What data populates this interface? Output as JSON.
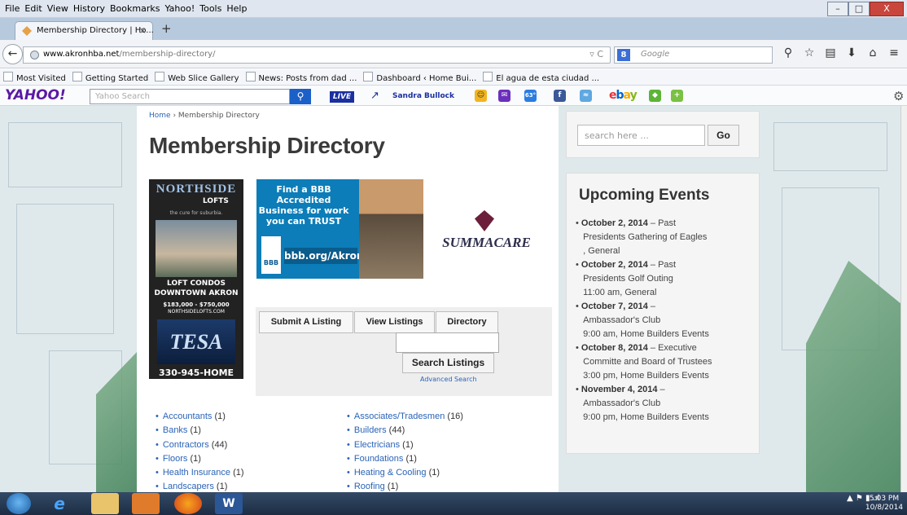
{
  "browser": {
    "menu": [
      "File",
      "Edit",
      "View",
      "History",
      "Bookmarks",
      "Yahoo!",
      "Tools",
      "Help"
    ],
    "tab_title": "Membership Directory | Ho...",
    "tab_close": "×",
    "new_tab": "+",
    "url_host": "www.akronhba.net",
    "url_path": "/membership-directory/",
    "url_controls": "▿ C",
    "search_engine_placeholder": "Google",
    "bookmarks": [
      "Most Visited",
      "Getting Started",
      "Web Slice Gallery",
      "News: Posts from dad ...",
      "Dashboard ‹ Home Bui...",
      "El agua de esta ciudad ..."
    ],
    "window_controls": [
      "–",
      "□",
      "X"
    ]
  },
  "yahoo_toolbar": {
    "logo": "YAHOO!",
    "search_placeholder": "Yahoo Search",
    "live_label": "LIVE",
    "trending_name": "Sandra Bullock",
    "weather_temp": "63°",
    "ebay_label": "ebay"
  },
  "page": {
    "breadcrumb_home": "Home",
    "breadcrumb_sep": " › ",
    "breadcrumb_current": "Membership Directory",
    "title": "Membership Directory",
    "ad_northside": {
      "brand": "NORTHSIDE",
      "brand_sub": "LOFTS",
      "tagline": "the cure for suburbia.",
      "headline": "LOFT CONDOS DOWNTOWN AKRON",
      "price": "$183,000 - $750,000",
      "site": "NORTHSIDELOFTS.COM",
      "logo_text": "TESA",
      "phone": "330-945-HOME"
    },
    "ad_bbb": {
      "headline": "Find a BBB Accredited Business for work you can TRUST",
      "logo": "BBB",
      "url": "bbb.org/Akron"
    },
    "ad_summacare": "SUMMACARE",
    "listing_tabs": {
      "submit": "Submit A Listing",
      "view": "View Listings",
      "directory": "Directory"
    },
    "search_listings_button": "Search Listings",
    "advanced_search": "Advanced Search",
    "categories_left": [
      {
        "name": "Accountants",
        "count": "(1)"
      },
      {
        "name": "Banks",
        "count": "(1)"
      },
      {
        "name": "Contractors",
        "count": "(44)"
      },
      {
        "name": "Floors",
        "count": "(1)"
      },
      {
        "name": "Health Insurance",
        "count": "(1)"
      },
      {
        "name": "Landscapers",
        "count": "(1)"
      }
    ],
    "categories_right": [
      {
        "name": "Associates/Tradesmen",
        "count": "(16)"
      },
      {
        "name": "Builders",
        "count": "(44)"
      },
      {
        "name": "Electricians",
        "count": "(1)"
      },
      {
        "name": "Foundations",
        "count": "(1)"
      },
      {
        "name": "Heating & Cooling",
        "count": "(1)"
      },
      {
        "name": "Roofing",
        "count": "(1)"
      }
    ],
    "bullet": "•"
  },
  "sidebar": {
    "search_placeholder": "search here ...",
    "go_button": "Go",
    "events_title": "Upcoming Events",
    "events": [
      {
        "date": "October 2, 2014",
        "line1": " – Past",
        "line2": "Presidents Gathering of Eagles",
        "line3": ", General"
      },
      {
        "date": "October 2, 2014",
        "line1": " – Past",
        "line2": "Presidents Golf Outing",
        "line3": "11:00 am, General"
      },
      {
        "date": "October 7, 2014",
        "line1": " –",
        "line2": "Ambassador's Club",
        "line3": "9:00 am, Home Builders Events"
      },
      {
        "date": "October 8, 2014",
        "line1": " – Executive",
        "line2": "Committe and Board of Trustees",
        "line3": "3:00 pm, Home Builders Events"
      },
      {
        "date": "November 4, 2014",
        "line1": " –",
        "line2": "Ambassador's Club",
        "line3": "9:00 pm, Home Builders Events"
      }
    ]
  },
  "taskbar": {
    "word_label": "W",
    "time": "5:03 PM",
    "date": "10/8/2014"
  },
  "colors": {
    "link": "#2a64b8",
    "yahoo_purple": "#5b1aa3",
    "bbb_blue": "#0c7db8"
  }
}
